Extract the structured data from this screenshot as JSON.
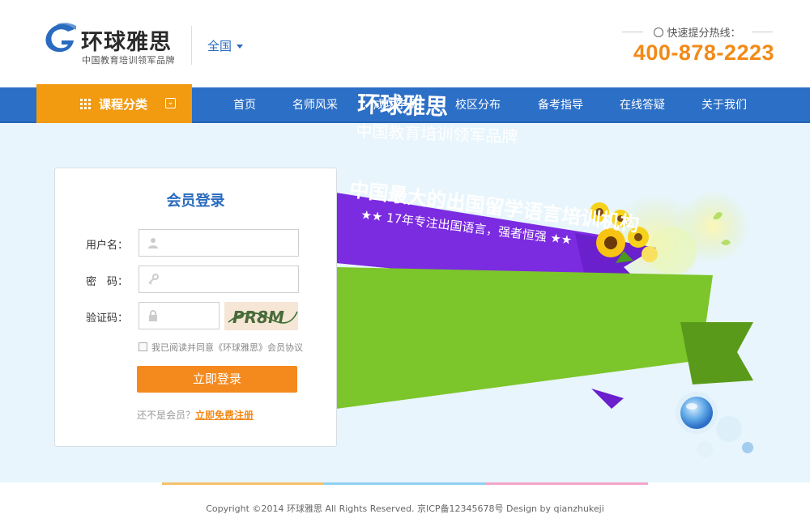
{
  "header": {
    "logo_title": "环球雅思",
    "logo_subtitle": "中国教育培训领军品牌",
    "region": "全国",
    "hotline_label": "快速提分热线：",
    "hotline_number": "400-878-2223"
  },
  "nav": {
    "category_label": "课程分类",
    "items": [
      "首页",
      "名师风采",
      "成功学员",
      "校区分布",
      "备考指导",
      "在线答疑",
      "关于我们"
    ]
  },
  "login": {
    "title": "会员登录",
    "username_label": "用户名：",
    "password_label": "密　码：",
    "captcha_label": "验证码：",
    "captcha_text": "PR8M",
    "agree_text": "我已阅读并同意《环球雅思》会员协议",
    "submit_label": "立即登录",
    "register_prompt": "还不是会员？",
    "register_link": "立即免费注册"
  },
  "banner": {
    "line1": "环球雅思",
    "line2": "中国教育培训领军品牌",
    "line3": "中国最大的出国留学语言培训机构",
    "line4": "★★ 17年专注出国语言，强者恒强 ★★"
  },
  "footer": {
    "copyright": "Copyright ©2014 环球雅思 All Rights Reserved. 京ICP备12345678号  Design by qianzhukeji"
  },
  "colors": {
    "primary_blue": "#2c6fc6",
    "accent_orange": "#f29a10",
    "button_orange": "#f48a1e",
    "banner_purple": "#7b2be0",
    "banner_green": "#7cc52a",
    "background": "#e8f5fc"
  },
  "icons": [
    "logo-g-icon",
    "phone-icon",
    "grid-icon",
    "chevron-down-icon",
    "user-icon",
    "key-icon",
    "lock-icon"
  ]
}
